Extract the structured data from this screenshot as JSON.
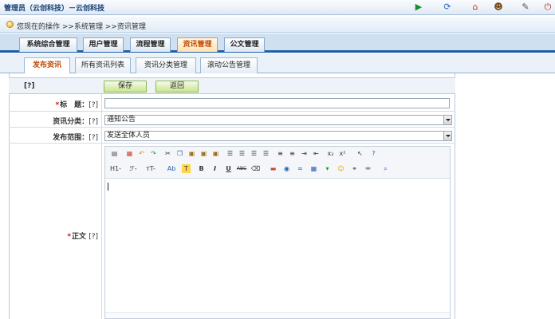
{
  "app": {
    "title": "管理员（云创科技）－云创科技"
  },
  "top_icons": [
    "play-icon",
    "refresh-icon",
    "home-icon",
    "user-icon",
    "edit-icon",
    "exit-icon"
  ],
  "breadcrumb": {
    "text": "您现在的操作 >>系统管理 >>资讯管理"
  },
  "main_tabs": [
    {
      "label": "系统综合管理"
    },
    {
      "label": "用户管理"
    },
    {
      "label": "流程管理"
    },
    {
      "label": "资讯管理"
    },
    {
      "label": "公文管理"
    }
  ],
  "sub_tabs": [
    {
      "label": "发布资讯"
    },
    {
      "label": "所有资讯列表"
    },
    {
      "label": "资讯分类管理"
    },
    {
      "label": "滚动公告管理"
    }
  ],
  "form": {
    "help_top": "[?]",
    "save_label": "保存",
    "back_label": "返回",
    "title_label": "标　题：",
    "title_help": "[?]",
    "title_value": "",
    "category_label": "资讯分类：",
    "category_help": "[?]",
    "category_value": "通知公告",
    "scope_label": "发布范围：",
    "scope_help": "[?]",
    "scope_value": "发送全体人员",
    "body_label": "正文",
    "body_help": "[?]"
  },
  "editor_toolbar": {
    "row2_text": [
      "H1-",
      "ℱ-",
      "тT-",
      "Ab",
      "B",
      "I",
      "U",
      "ABC"
    ]
  },
  "colors": {
    "active_tab_text": "#c04b00",
    "nav_bar": "#1d5fa6",
    "button_green": "#c8e58e",
    "required": "#d01010"
  }
}
